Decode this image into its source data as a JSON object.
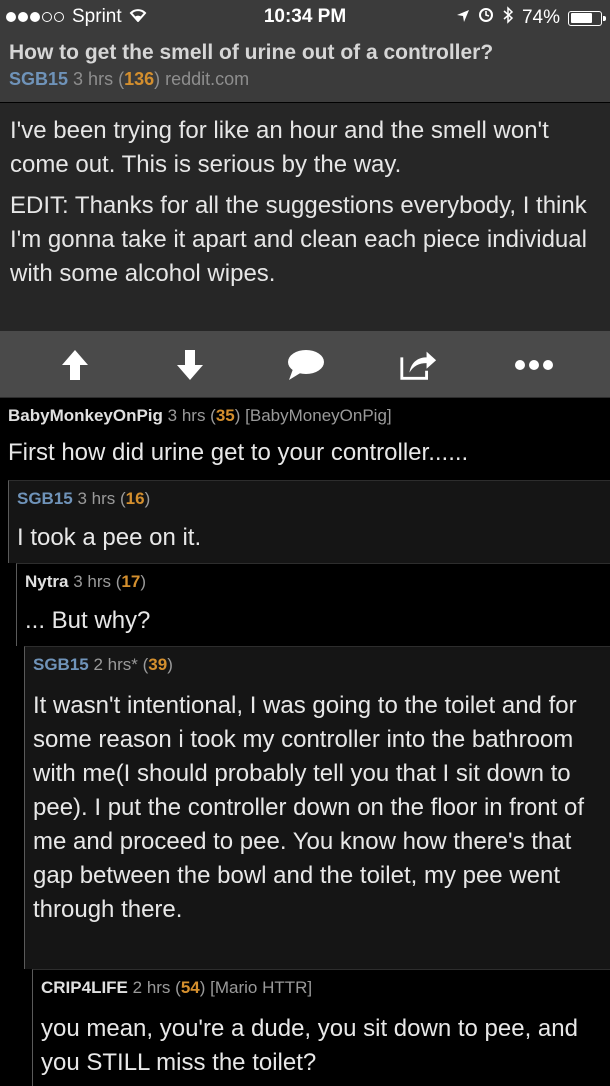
{
  "status_bar": {
    "carrier": "Sprint",
    "time": "10:34 PM",
    "battery": "74%",
    "battery_level": 0.74
  },
  "post": {
    "title": "How to get the smell of urine out of a controller?",
    "author": "SGB15",
    "age": "3 hrs",
    "score": "136",
    "domain": "reddit.com",
    "paragraphs": [
      "I've been trying for like an hour and the smell won't come out. This is serious by the way.",
      "EDIT: Thanks for all the suggestions everybody, I think I'm gonna take it apart and clean each piece individual with some alcohol wipes."
    ]
  },
  "actions": [
    "upvote-icon",
    "downvote-icon",
    "comment-icon",
    "share-icon",
    "more-icon"
  ],
  "comments": [
    {
      "author": "BabyMonkeyOnPig",
      "age": "3 hrs",
      "score": "35",
      "flair": "[BabyMoneyOnPig]",
      "body": "First how did urine get to your controller......"
    },
    {
      "author": "SGB15",
      "age": "3 hrs",
      "score": "16",
      "flair": "",
      "body": "I took a pee on it."
    },
    {
      "author": "Nytra",
      "age": "3 hrs",
      "score": "17",
      "flair": "",
      "body": "... But why?"
    },
    {
      "author": "SGB15",
      "age": "2 hrs*",
      "score": "39",
      "flair": "",
      "body": "It wasn't intentional, I was going to the toilet and for some reason i took my controller into the bathroom with me(I should probably tell you that I sit down to pee). I put the controller down on the floor in front of me and proceed to pee. You know how there's that gap between the bowl and the toilet, my pee went through there."
    },
    {
      "author": "CRIP4LIFE",
      "age": "2 hrs",
      "score": "54",
      "flair": "[Mario HTTR]",
      "body": "you mean, you're a dude, you sit down to pee, and you STILL miss the toilet?"
    }
  ]
}
